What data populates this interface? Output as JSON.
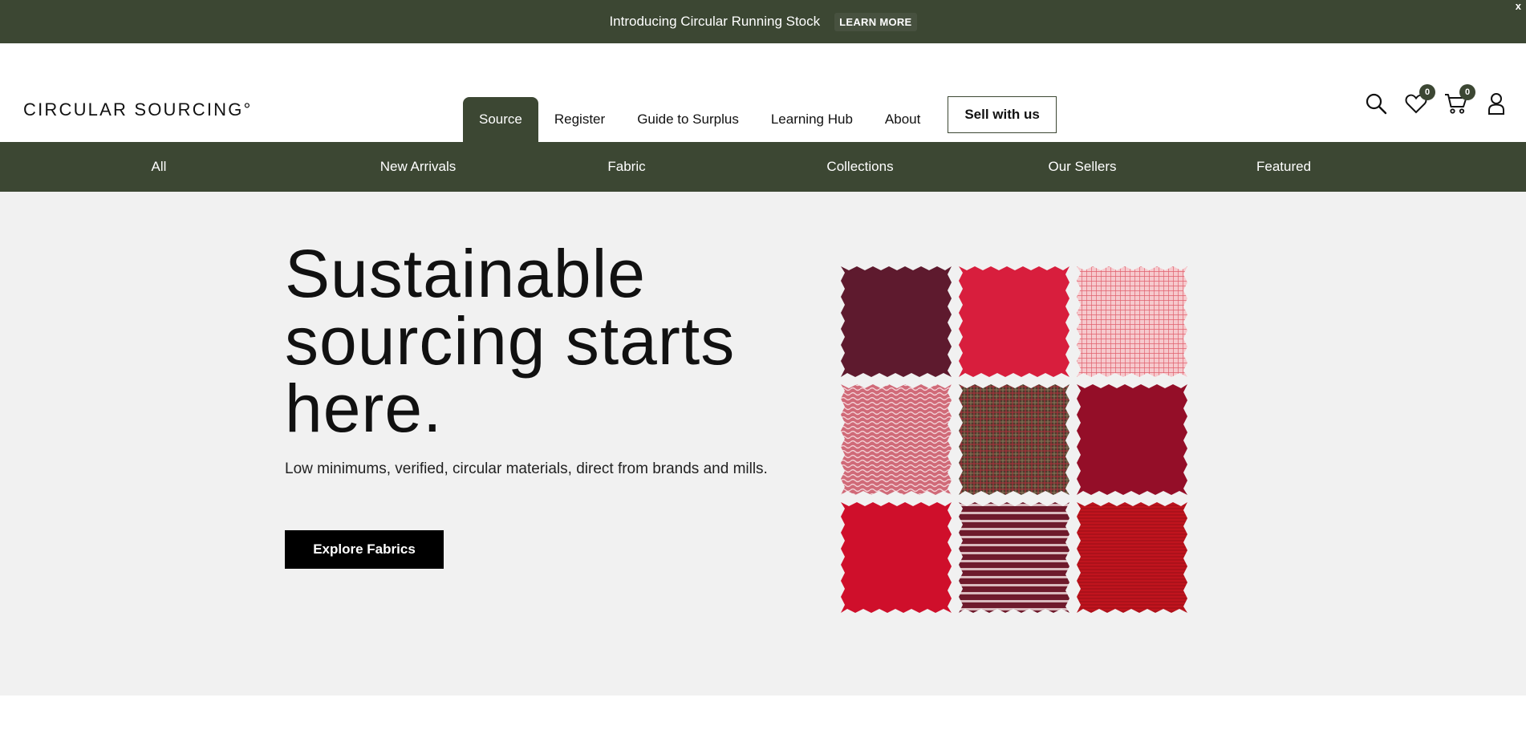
{
  "announcement": {
    "text": "Introducing Circular Running Stock",
    "link_label": "LEARN MORE",
    "close_label": "x"
  },
  "header": {
    "logo": "CIRCULAR SOURCING°",
    "nav": [
      {
        "label": "Source",
        "active": true
      },
      {
        "label": "Register",
        "active": false
      },
      {
        "label": "Guide to Surplus",
        "active": false
      },
      {
        "label": "Learning Hub",
        "active": false
      },
      {
        "label": "About",
        "active": false
      }
    ],
    "sell_label": "Sell with us",
    "icons": {
      "search": "search-icon",
      "wishlist": "heart-icon",
      "cart": "cart-icon",
      "account": "user-icon"
    },
    "wishlist_count": "0",
    "cart_count": "0"
  },
  "categories": [
    "All",
    "New Arrivals",
    "Fabric",
    "Collections",
    "Our Sellers",
    "Featured"
  ],
  "hero": {
    "title_line1": "Sustainable",
    "title_line2": "sourcing starts",
    "title_line3": "here.",
    "subtitle": "Low minimums, verified, circular materials, direct from brands and mills.",
    "cta_label": "Explore Fabrics",
    "swatch_colors": [
      "#5e1a2e",
      "#d81e3d",
      "#f0a7ae",
      "#cf4a5c",
      "#4e3a2d",
      "#940e28",
      "#cf0f2b",
      "#7a2334",
      "#c0141e"
    ]
  },
  "colors": {
    "brand_green": "#3c4733",
    "hero_bg": "#f1f1f1"
  }
}
